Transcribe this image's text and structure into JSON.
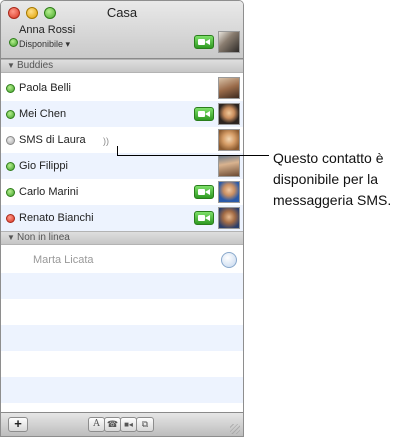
{
  "window": {
    "title": "Casa"
  },
  "me": {
    "name": "Anna Rossi",
    "status": "Disponibile ▾"
  },
  "groups": [
    {
      "label": "Buddies"
    },
    {
      "label": "Non in linea"
    }
  ],
  "buddies": [
    {
      "name": "Paola Belli",
      "status": "available",
      "video": false
    },
    {
      "name": "Mei Chen",
      "status": "available",
      "video": true
    },
    {
      "name": "SMS di Laura",
      "status": "sms",
      "video": false
    },
    {
      "name": "Gio Filippi",
      "status": "available",
      "video": false
    },
    {
      "name": "Carlo Marini",
      "status": "available",
      "video": true
    },
    {
      "name": "Renato Bianchi",
      "status": "busy",
      "video": true
    }
  ],
  "offline": [
    {
      "name": "Marta Licata"
    }
  ],
  "toolbar": {
    "add_label": "+",
    "text_label": "A",
    "audio_label": "☎",
    "video_label": "■◂",
    "share_label": "⧉"
  },
  "callout": {
    "line1": "Questo contatto è",
    "line2": "disponibile per la",
    "line3": "messaggeria SMS."
  },
  "colors": {
    "available": "#3fa02a",
    "busy": "#d8321f",
    "offline": "#a9a9a9",
    "row_alt": "#edf3fe"
  }
}
